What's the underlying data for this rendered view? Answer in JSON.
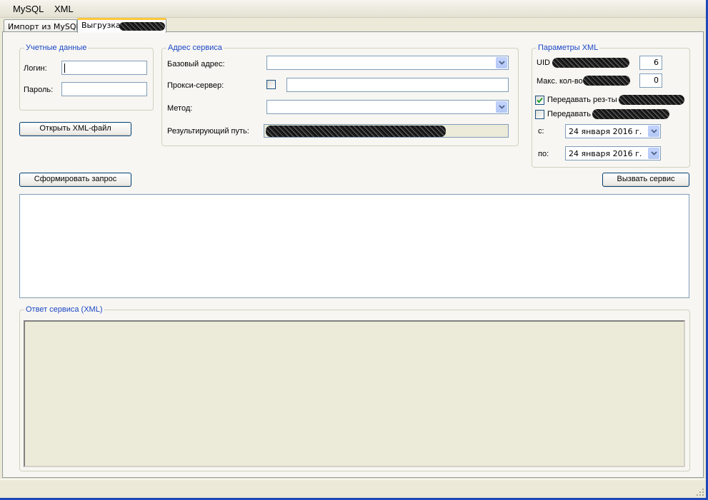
{
  "menu": {
    "items": [
      "MySQL",
      "XML"
    ]
  },
  "tabs": [
    {
      "label": "Импорт из MySQL",
      "active": false
    },
    {
      "label": "Выгрузка",
      "active": true
    }
  ],
  "credentials": {
    "legend": "Учетные данные",
    "login_label": "Логин:",
    "login_value": "",
    "password_label": "Пароль:",
    "password_value": ""
  },
  "open_xml_button": "Открыть XML-файл",
  "service": {
    "legend": "Адрес сервиса",
    "base_address_label": "Базовый адрес:",
    "base_address_value": "",
    "proxy_label": "Прокси-сервер:",
    "proxy_checked": false,
    "proxy_value": "",
    "method_label": "Метод:",
    "method_value": "",
    "result_path_label": "Результирующий путь:"
  },
  "xml_params": {
    "legend": "Параметры XML",
    "uid_label": "UID",
    "uid_value": "6",
    "max_count_label": "Макс. кол-во",
    "max_count_value": "0",
    "send_results_label": "Передавать рез-ты",
    "send_results_checked": true,
    "send_other_label": "Передавать",
    "send_other_checked": false,
    "from_label": "с:",
    "from_date": "24   января   2016 г.",
    "to_label": "по:",
    "to_date": "24   января   2016 г."
  },
  "build_request_button": "Сформировать запрос",
  "call_service_button": "Вызвать сервис",
  "response": {
    "legend": "Ответ сервиса (XML)"
  },
  "colors": {
    "group_title": "#1c47c6",
    "tab_highlight": "#ffc83c",
    "window_frame": "#1f48b8"
  }
}
